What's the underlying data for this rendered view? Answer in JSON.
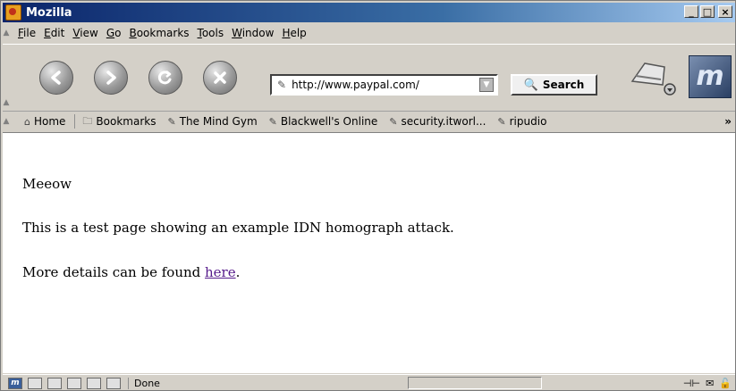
{
  "window": {
    "title": "Mozilla",
    "min": "_",
    "max": "□",
    "close": "×"
  },
  "menu": [
    {
      "label": "File",
      "mn": "F",
      "rest": "ile"
    },
    {
      "label": "Edit",
      "mn": "E",
      "rest": "dit"
    },
    {
      "label": "View",
      "mn": "V",
      "rest": "iew"
    },
    {
      "label": "Go",
      "mn": "G",
      "rest": "o"
    },
    {
      "label": "Bookmarks",
      "mn": "B",
      "rest": "ookmarks"
    },
    {
      "label": "Tools",
      "mn": "T",
      "rest": "ools"
    },
    {
      "label": "Window",
      "mn": "W",
      "rest": "indow"
    },
    {
      "label": "Help",
      "mn": "H",
      "rest": "elp"
    }
  ],
  "navigation": {
    "back_icon": "back-arrow",
    "forward_icon": "forward-arrow",
    "reload_icon": "reload",
    "stop_icon": "stop",
    "url": "http://www.paypal.com/",
    "search_label": "Search"
  },
  "personal_toolbar": {
    "items": [
      "Home",
      "Bookmarks",
      "The Mind Gym",
      "Blackwell's Online",
      "security.itworl...",
      "ripudio"
    ],
    "overflow": "»"
  },
  "content": {
    "line1": "Meeow",
    "line2": "This is a test page showing an example IDN homograph attack.",
    "line3_prefix": "More details can be found ",
    "line3_link": "here",
    "line3_suffix": "."
  },
  "status": {
    "text": "Done"
  },
  "colors": {
    "link": "#551a8b",
    "chrome": "#d4d0c8",
    "titlebar": "#0a246a"
  }
}
